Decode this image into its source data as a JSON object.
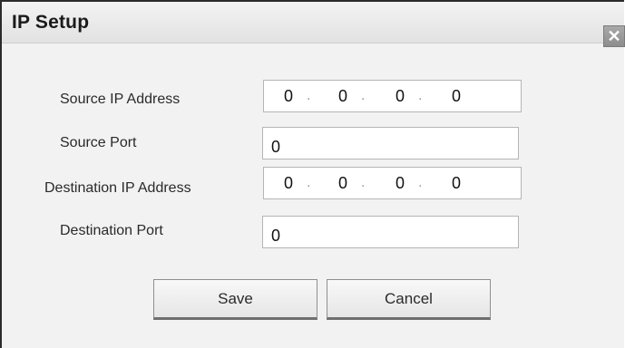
{
  "dialog": {
    "title": "IP Setup",
    "close_glyph": "✕"
  },
  "fields": {
    "source_ip": {
      "label": "Source IP Address",
      "octets": [
        "0",
        "0",
        "0",
        "0"
      ]
    },
    "source_port": {
      "label": "Source Port",
      "value": "0"
    },
    "destination_ip": {
      "label": "Destination IP Address",
      "octets": [
        "0",
        "0",
        "0",
        "0"
      ]
    },
    "destination_port": {
      "label": "Destination Port",
      "value": "0"
    }
  },
  "buttons": {
    "save_label": "Save",
    "cancel_label": "Cancel"
  },
  "icons": {
    "close": "close-icon"
  },
  "colors": {
    "background": "#f2f2f2",
    "titlebar": "#e8e8e8",
    "close_button": "#999999",
    "field_border": "#b5b5b5"
  }
}
